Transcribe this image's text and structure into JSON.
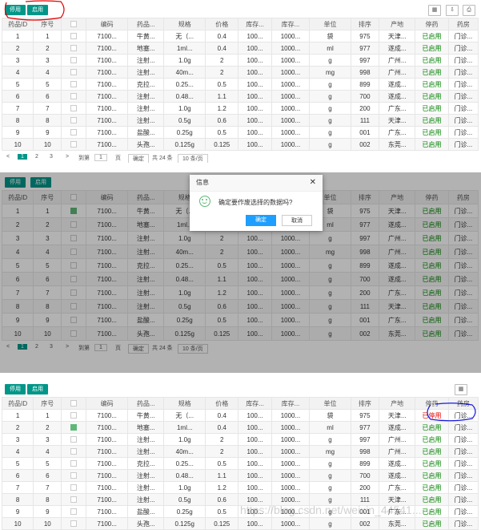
{
  "toolbar": {
    "disable_label": "停用",
    "enable_label": "启用",
    "icon_grid": "▦",
    "icon_print": "⎙",
    "icon_export": "⇩"
  },
  "columns": [
    "药品ID",
    "序号",
    "",
    "编码",
    "药品...",
    "规格",
    "价格",
    "库存...",
    "库存...",
    "单位",
    "排序",
    "产地",
    "停药",
    "药房"
  ],
  "rows": [
    {
      "id": "1",
      "seq": "1",
      "code": "7100...",
      "name": "牛黄...",
      "spec": "无（...",
      "price": "0.4",
      "stock1": "100...",
      "stock2": "1000...",
      "unit": "袋",
      "sort": "975",
      "origin": "天津...",
      "status": "已启用",
      "pharmacy": "门诊..."
    },
    {
      "id": "2",
      "seq": "2",
      "code": "7100...",
      "name": "地塞...",
      "spec": "1ml...",
      "price": "0.4",
      "stock1": "100...",
      "stock2": "1000...",
      "unit": "ml",
      "sort": "977",
      "origin": "遂成...",
      "status": "已启用",
      "pharmacy": "门诊..."
    },
    {
      "id": "3",
      "seq": "3",
      "code": "7100...",
      "name": "注射...",
      "spec": "1.0g",
      "price": "2",
      "stock1": "100...",
      "stock2": "1000...",
      "unit": "g",
      "sort": "997",
      "origin": "广州...",
      "status": "已启用",
      "pharmacy": "门诊..."
    },
    {
      "id": "4",
      "seq": "4",
      "code": "7100...",
      "name": "注射...",
      "spec": "40m...",
      "price": "2",
      "stock1": "100...",
      "stock2": "1000...",
      "unit": "mg",
      "sort": "998",
      "origin": "广州...",
      "status": "已启用",
      "pharmacy": "门诊..."
    },
    {
      "id": "5",
      "seq": "5",
      "code": "7100...",
      "name": "克拉...",
      "spec": "0.25...",
      "price": "0.5",
      "stock1": "100...",
      "stock2": "1000...",
      "unit": "g",
      "sort": "899",
      "origin": "遂成...",
      "status": "已启用",
      "pharmacy": "门诊..."
    },
    {
      "id": "6",
      "seq": "6",
      "code": "7100...",
      "name": "注射...",
      "spec": "0.48...",
      "price": "1.1",
      "stock1": "100...",
      "stock2": "1000...",
      "unit": "g",
      "sort": "700",
      "origin": "遂成...",
      "status": "已启用",
      "pharmacy": "门诊..."
    },
    {
      "id": "7",
      "seq": "7",
      "code": "7100...",
      "name": "注射...",
      "spec": "1.0g",
      "price": "1.2",
      "stock1": "100...",
      "stock2": "1000...",
      "unit": "g",
      "sort": "200",
      "origin": "广东...",
      "status": "已启用",
      "pharmacy": "门诊..."
    },
    {
      "id": "8",
      "seq": "8",
      "code": "7100...",
      "name": "注射...",
      "spec": "0.5g",
      "price": "0.6",
      "stock1": "100...",
      "stock2": "1000...",
      "unit": "g",
      "sort": "111",
      "origin": "天津...",
      "status": "已启用",
      "pharmacy": "门诊..."
    },
    {
      "id": "9",
      "seq": "9",
      "code": "7100...",
      "name": "盐酸...",
      "spec": "0.25g",
      "price": "0.5",
      "stock1": "100...",
      "stock2": "1000...",
      "unit": "g",
      "sort": "001",
      "origin": "广东...",
      "status": "已启用",
      "pharmacy": "门诊..."
    },
    {
      "id": "10",
      "seq": "10",
      "code": "7100...",
      "name": "头孢...",
      "spec": "0.125g",
      "price": "0.125",
      "stock1": "100...",
      "stock2": "1000...",
      "unit": "g",
      "sort": "002",
      "origin": "东莞...",
      "status": "已启用",
      "pharmacy": "门诊..."
    }
  ],
  "pager": {
    "prev": "<",
    "p1": "1",
    "p2": "2",
    "p3": "3",
    "next": ">",
    "goto": "到第",
    "page_input": "1",
    "page_unit": "页",
    "confirm": "确定",
    "total": "共 24 条",
    "page_size": "10 条/页"
  },
  "dialog": {
    "title": "信息",
    "close": "✕",
    "message": "确定要作废选择的数据吗?",
    "ok": "确定",
    "cancel": "取消"
  },
  "stopped_status": "已停用",
  "watermark": "https://blog.csdn.net/weixin_44541...",
  "colors": {
    "green": "#009688",
    "blue": "#1e9fff",
    "status_green": "#008000",
    "status_red": "#e60000",
    "annot_red": "#e60000",
    "annot_blue": "#1a1ae0"
  }
}
